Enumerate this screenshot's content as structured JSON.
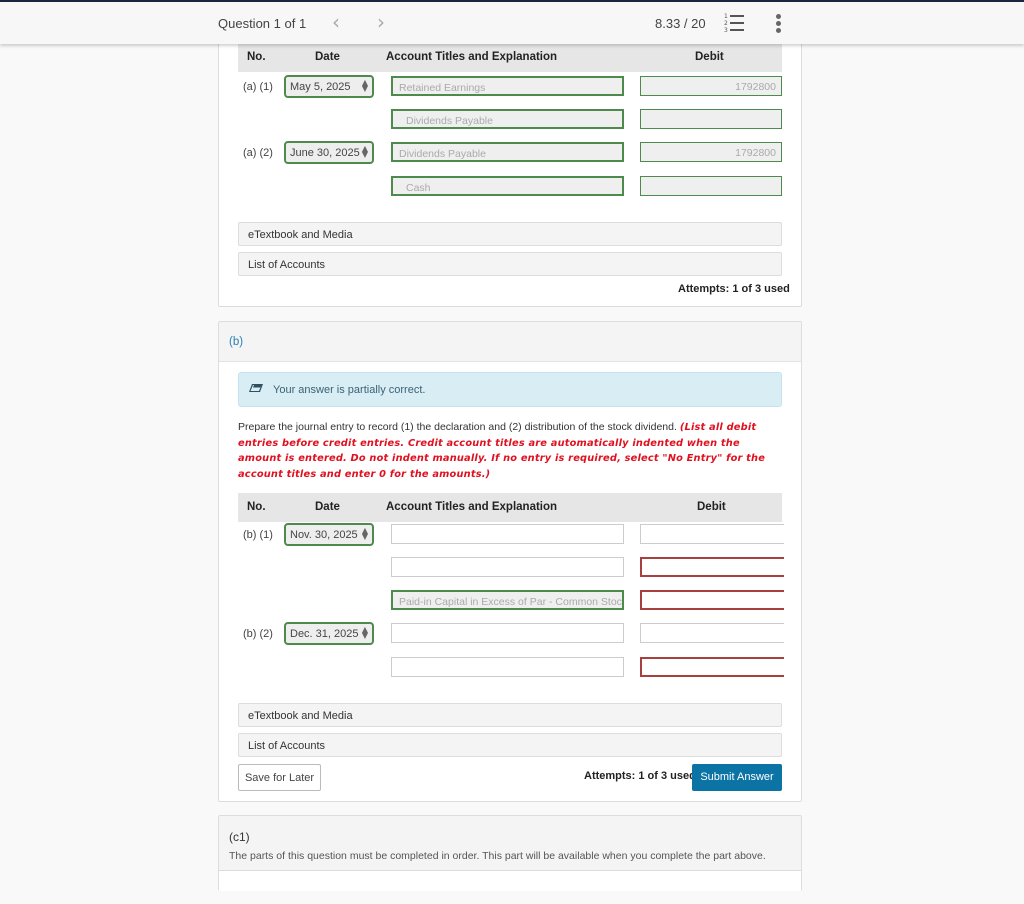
{
  "topbar": {
    "question_label": "Question 1 of 1",
    "prev_icon": "chevron-left-icon",
    "next_icon": "chevron-right-icon",
    "prev_glyph": "‹",
    "next_glyph": "›",
    "score": "8.33 / 20",
    "list_icon_numbers": [
      "1",
      "2",
      "3"
    ],
    "more_icon": "vertical-dots-icon"
  },
  "table_headers": {
    "no": "No.",
    "date": "Date",
    "account": "Account Titles and Explanation",
    "debit": "Debit"
  },
  "part_a": {
    "entries": [
      {
        "no": "(a) (1)",
        "date": "May 5, 2025",
        "lines": [
          {
            "account": "Retained Earnings",
            "debit": "1792800",
            "state": "correct"
          },
          {
            "account": "Dividends Payable",
            "debit": "",
            "state": "correct"
          }
        ]
      },
      {
        "no": "(a) (2)",
        "date": "June 30, 2025",
        "lines": [
          {
            "account": "Dividends Payable",
            "debit": "1792800",
            "state": "correct"
          },
          {
            "account": "Cash",
            "debit": "",
            "state": "correct"
          }
        ]
      }
    ],
    "etextbook_label": "eTextbook and Media",
    "list_accounts_label": "List of Accounts",
    "attempts": "Attempts: 1 of 3 used"
  },
  "part_b": {
    "label": "(b)",
    "alert_text": "Your answer is partially correct.",
    "alert_icon": "pencil-icon",
    "instruction_plain": "Prepare the journal entry to record (1) the declaration and (2) distribution of the stock dividend.",
    "instruction_red": "(List all debit entries before credit entries. Credit account titles are automatically indented when the amount is entered. Do not indent manually. If no entry is required, select \"No Entry\" for the account titles and enter 0 for the amounts.)",
    "entries": [
      {
        "no": "(b) (1)",
        "date": "Nov. 30, 2025",
        "lines": [
          {
            "account": "",
            "debit": "",
            "debit_state": "empty"
          },
          {
            "account": "",
            "debit": "",
            "debit_state": "incorrect"
          },
          {
            "account": "Paid-in Capital in Excess of Par - Common Stoc",
            "debit": "",
            "account_state": "correct",
            "debit_state": "incorrect"
          }
        ]
      },
      {
        "no": "(b) (2)",
        "date": "Dec. 31, 2025",
        "lines": [
          {
            "account": "",
            "debit": "",
            "debit_state": "empty"
          },
          {
            "account": "",
            "debit": "",
            "debit_state": "incorrect"
          }
        ]
      }
    ],
    "etextbook_label": "eTextbook and Media",
    "list_accounts_label": "List of Accounts",
    "save_label": "Save for Later",
    "attempts": "Attempts: 1 of 3 used",
    "submit_label": "Submit Answer"
  },
  "part_c1": {
    "label": "(c1)",
    "text": "The parts of this question must be completed in order. This part will be available when you complete the part above."
  },
  "colors": {
    "correct_border": "#4e8a4e",
    "incorrect_border": "#a84040",
    "submit_bg": "#0c73a5",
    "part_label": "#2a7fb3",
    "instruction_red": "#e0101f",
    "alert_bg": "#d9edf5"
  }
}
